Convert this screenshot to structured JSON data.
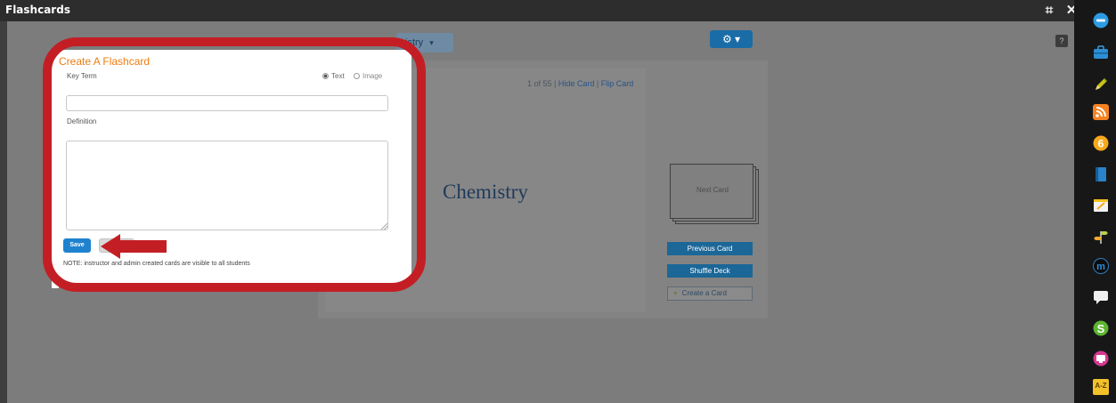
{
  "window": {
    "title": "Flashcards",
    "expand_glyph": "⌗",
    "close_glyph": "✕"
  },
  "toolbar": {
    "deck_select_value": "istry",
    "deck_select_caret": "▾",
    "settings_glyph": "⚙ ▾",
    "help_glyph": "?"
  },
  "viewer": {
    "counter": "1 of 55",
    "separator": " | ",
    "hide_card_link": "Hide Card",
    "flip_card_link": "Flip Card",
    "card_term": "Chemistry",
    "next_card_label": "Next Card",
    "previous_card_button": "Previous Card",
    "shuffle_deck_button": "Shuffle Deck",
    "create_card_button": "Create a Card"
  },
  "dialog": {
    "title": "Create A Flashcard",
    "key_term_label": "Key Term",
    "option_text": "Text",
    "option_image": "Image",
    "selected_option": "Text",
    "key_term_value": "",
    "definition_label": "Definition",
    "definition_value": "",
    "save_button": "Save",
    "cancel_button": "",
    "note": "NOTE: instructor and admin created cards are visible to all students"
  },
  "annotation": {
    "highlight_color": "#c41e25",
    "arrow_color": "#c41e25",
    "arrow_target": "save-button"
  },
  "dock": {
    "icons": [
      "badge-circle-icon",
      "briefcase-icon",
      "pencil-icon",
      "rss-icon",
      "six-circle-icon",
      "book-icon",
      "notepad-icon",
      "arrow-signs-icon",
      "m-circle-icon",
      "chat-bubble-icon",
      "s-circle-icon",
      "monitor-icon",
      "a-z-icon"
    ],
    "az_label": "A-Z"
  },
  "colors": {
    "accent_orange": "#ee7d12",
    "primary_blue": "#1f82cf",
    "dock_background": "#171717"
  }
}
